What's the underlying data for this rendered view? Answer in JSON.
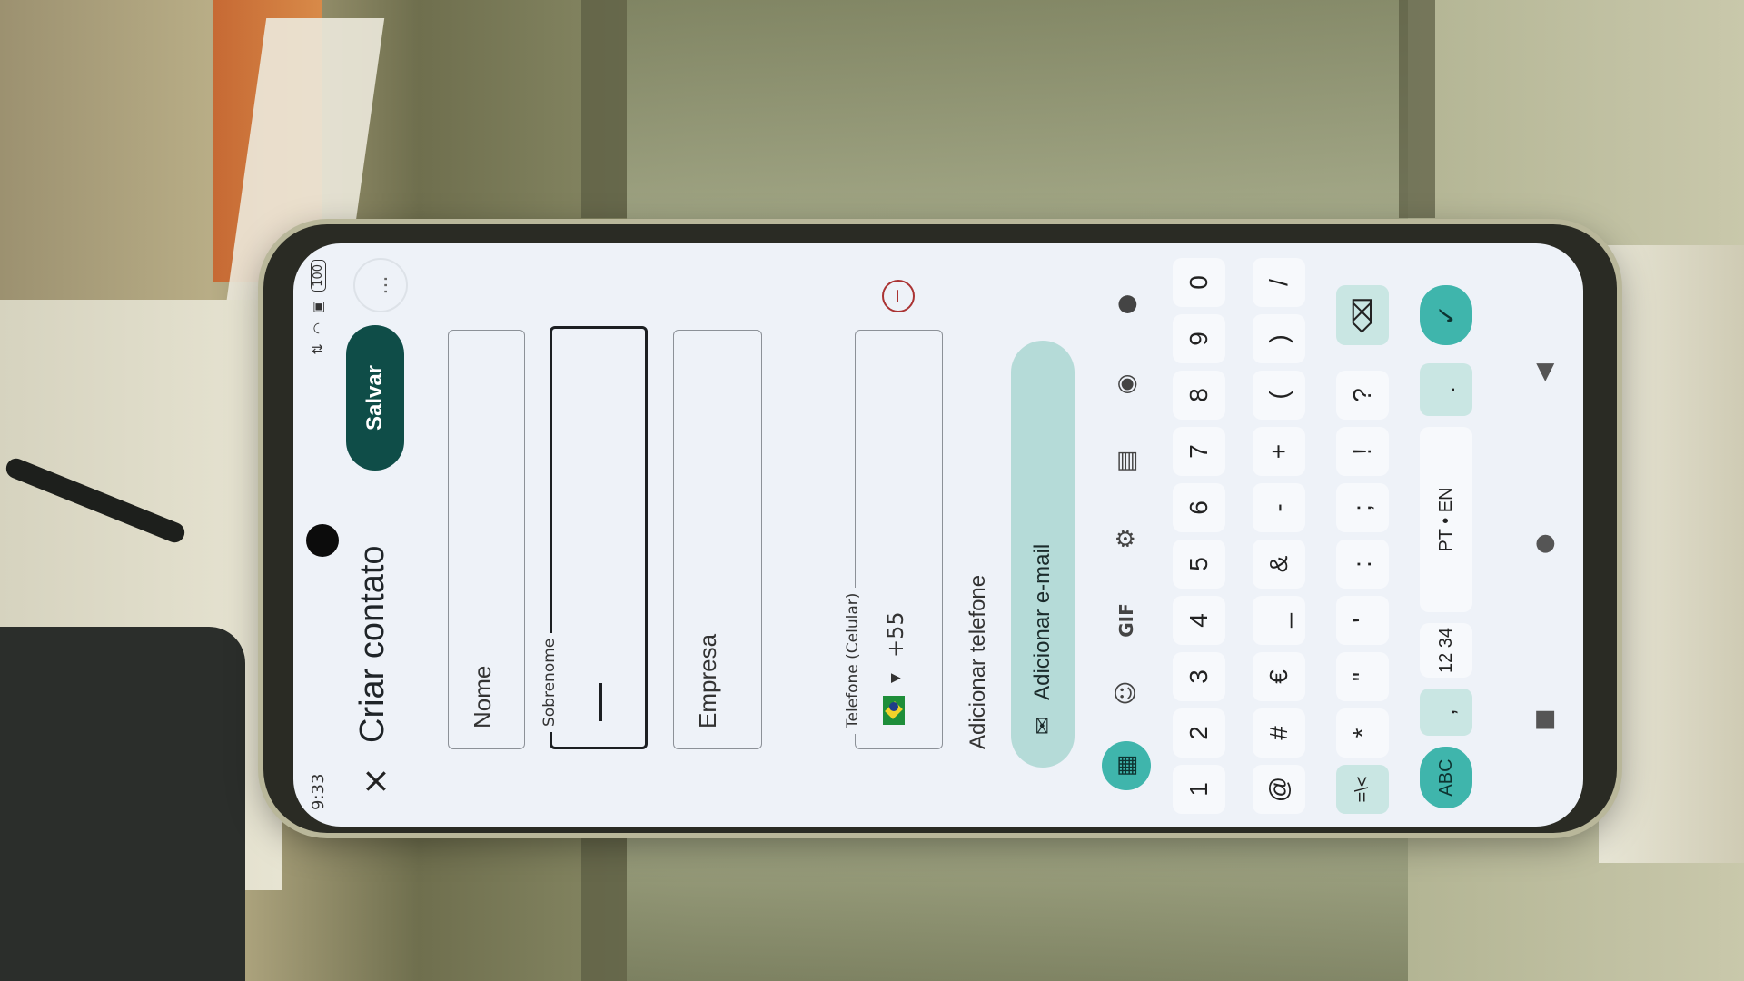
{
  "status": {
    "time": "9:33",
    "battery": "100"
  },
  "app": {
    "title": "Criar contato",
    "save_label": "Salvar",
    "more_label": "...",
    "close_label": "×"
  },
  "form": {
    "first_name_placeholder": "Nome",
    "last_name_label": "Sobrenome",
    "company_placeholder": "Empresa",
    "phone_label": "Telefone (Celular)",
    "country_code": "+55",
    "add_phone": "Adicionar telefone",
    "add_email": "Adicionar e-mail"
  },
  "keyboard": {
    "toolbar": [
      "grid-icon",
      "sticker-icon",
      "GIF",
      "gear-icon",
      "translate-icon",
      "palette-icon",
      "mic-icon"
    ],
    "gif_label": "GIF",
    "row1": [
      "1",
      "2",
      "3",
      "4",
      "5",
      "6",
      "7",
      "8",
      "9",
      "0"
    ],
    "row2": [
      "@",
      "#",
      "€",
      "_",
      "&",
      "-",
      "+",
      "(",
      ")",
      "/"
    ],
    "row3": [
      "=\\<",
      "*",
      "\"",
      "'",
      ":",
      ";",
      "!",
      "?"
    ],
    "row4": [
      "ABC",
      ",",
      "12\n34",
      "PT • EN",
      ".",
      "✓"
    ],
    "space_label": "PT • EN",
    "abc_label": "ABC",
    "num_label": "12 34"
  },
  "nav": [
    "back",
    "home",
    "recents"
  ]
}
